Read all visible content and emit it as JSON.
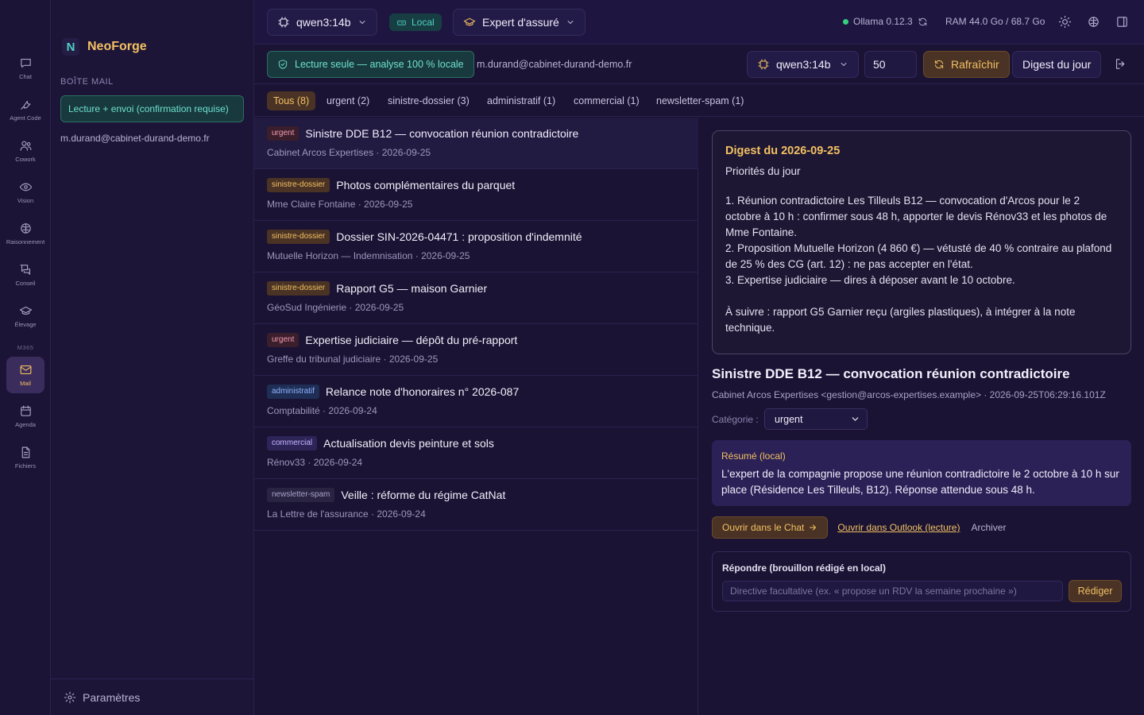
{
  "rail": {
    "items": [
      {
        "label": "Chat",
        "icon": "chat-icon"
      },
      {
        "label": "Agent Code",
        "icon": "wrench-icon"
      },
      {
        "label": "Cowork",
        "icon": "users-icon"
      },
      {
        "label": "Vision",
        "icon": "eye-icon"
      },
      {
        "label": "Raisonnement",
        "icon": "brain-icon"
      },
      {
        "label": "Conseil",
        "icon": "messages-icon"
      },
      {
        "label": "Élevage",
        "icon": "graduation-cap-icon"
      }
    ],
    "group_label": "M365",
    "m365_items": [
      {
        "label": "Mail",
        "icon": "mail-icon",
        "active": true
      },
      {
        "label": "Agenda",
        "icon": "calendar-icon"
      },
      {
        "label": "Fichiers",
        "icon": "file-icon"
      }
    ]
  },
  "sidebar": {
    "brand_letter": "N",
    "brand_name": "NeoForge",
    "section_title": "BOÎTE MAIL",
    "mode": "Lecture + envoi (confirmation requise)",
    "account": "m.durand@cabinet-durand-demo.fr",
    "settings_label": "Paramètres"
  },
  "topbar": {
    "model": "qwen3:14b",
    "local_label": "Local",
    "persona": "Expert d'assuré",
    "ollama": "Ollama 0.12.3",
    "ram": "RAM 44.0 Go / 68.7 Go"
  },
  "mailbar": {
    "readonly_label": "Lecture seule — analyse 100 % locale",
    "account": "m.durand@cabinet-durand-demo.fr",
    "model": "qwen3:14b",
    "count": "50",
    "refresh_label": "Rafraîchir",
    "digest_label": "Digest du jour"
  },
  "tabs": [
    {
      "label": "Tous (8)",
      "active": true
    },
    {
      "label": "urgent (2)"
    },
    {
      "label": "sinistre-dossier (3)"
    },
    {
      "label": "administratif (1)"
    },
    {
      "label": "commercial (1)"
    },
    {
      "label": "newsletter-spam (1)"
    }
  ],
  "messages": [
    {
      "tag": "urgent",
      "tag_class": "tag-urgent",
      "subject": "Sinistre DDE B12 — convocation réunion contradictoire",
      "meta": "Cabinet Arcos Expertises · 2026-09-25",
      "selected": true
    },
    {
      "tag": "sinistre-dossier",
      "tag_class": "tag-sinistre",
      "subject": "Photos complémentaires du parquet",
      "meta": "Mme Claire Fontaine · 2026-09-25"
    },
    {
      "tag": "sinistre-dossier",
      "tag_class": "tag-sinistre",
      "subject": "Dossier SIN-2026-04471 : proposition d'indemnité",
      "meta": "Mutuelle Horizon — Indemnisation · 2026-09-25"
    },
    {
      "tag": "sinistre-dossier",
      "tag_class": "tag-sinistre",
      "subject": "Rapport G5 — maison Garnier",
      "meta": "GéoSud Ingénierie · 2026-09-25"
    },
    {
      "tag": "urgent",
      "tag_class": "tag-urgent",
      "subject": "Expertise judiciaire — dépôt du pré-rapport",
      "meta": "Greffe du tribunal judiciaire · 2026-09-25"
    },
    {
      "tag": "administratif",
      "tag_class": "tag-admin",
      "subject": "Relance note d'honoraires n° 2026-087",
      "meta": "Comptabilité · 2026-09-24"
    },
    {
      "tag": "commercial",
      "tag_class": "tag-commercial",
      "subject": "Actualisation devis peinture et sols",
      "meta": "Rénov33 · 2026-09-24"
    },
    {
      "tag": "newsletter-spam",
      "tag_class": "tag-news",
      "subject": "Veille : réforme du régime CatNat",
      "meta": "La Lettre de l'assurance · 2026-09-24"
    }
  ],
  "digest": {
    "title": "Digest du 2026-09-25",
    "subtitle": "Priorités du jour",
    "items": [
      "1. Réunion contradictoire Les Tilleuls B12 — convocation d'Arcos pour le 2 octobre à 10 h : confirmer sous 48 h, apporter le devis Rénov33 et les photos de Mme Fontaine.",
      "2. Proposition Mutuelle Horizon (4 860 €) — vétusté de 40 % contraire au plafond de 25 % des CG (art. 12) : ne pas accepter en l'état.",
      "3. Expertise judiciaire — dires à déposer avant le 10 octobre."
    ],
    "followup": "À suivre : rapport G5 Garnier reçu (argiles plastiques), à intégrer à la note technique."
  },
  "detail": {
    "subject": "Sinistre DDE B12 — convocation réunion contradictoire",
    "from": "Cabinet Arcos Expertises <gestion@arcos-expertises.example> · 2026-09-25T06:29:16.101Z",
    "category_label": "Catégorie :",
    "category_value": "urgent",
    "summary_title": "Résumé (local)",
    "summary_text": "L'expert de la compagnie propose une réunion contradictoire le 2 octobre à 10 h sur place (Résidence Les Tilleuls, B12). Réponse attendue sous 48 h.",
    "open_chat": "Ouvrir dans le Chat",
    "open_outlook": "Ouvrir dans Outlook (lecture)",
    "archive": "Archiver",
    "reply_title": "Répondre (brouillon rédigé en local)",
    "reply_placeholder": "Directive facultative (ex. « propose un RDV la semaine prochaine »)",
    "draft_label": "Rédiger"
  },
  "colors": {
    "accent": "#f2c062",
    "teal": "#4fd1c5",
    "background": "#1a1333",
    "status_ok": "#35d07f"
  }
}
